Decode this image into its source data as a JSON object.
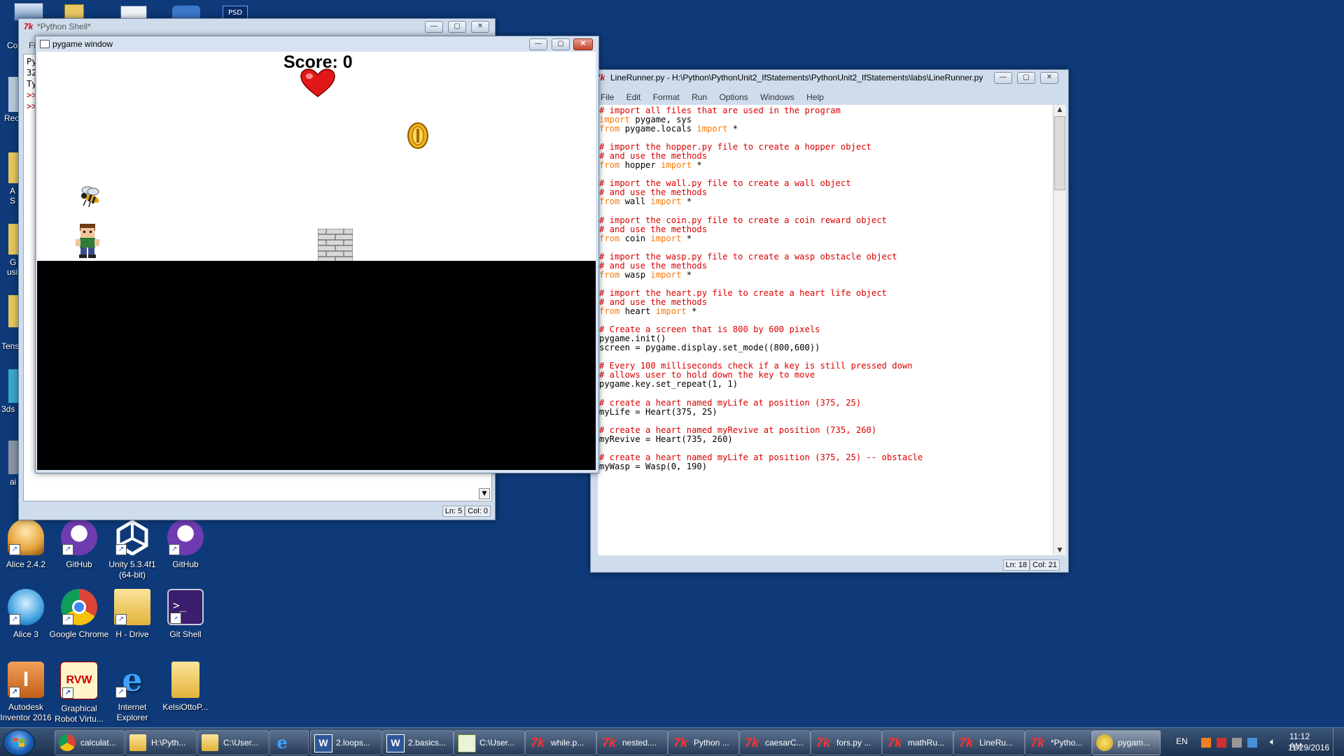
{
  "desktop": {
    "icons": [
      {
        "label": "Alice 2.4.2"
      },
      {
        "label": "GitHub"
      },
      {
        "label": "Unity 5.3.4f1 (64-bit)"
      },
      {
        "label": "GitHub"
      },
      {
        "label": "Alice 3"
      },
      {
        "label": "Google Chrome"
      },
      {
        "label": "H - Drive"
      },
      {
        "label": "Git Shell"
      },
      {
        "label": "Autodesk Inventor 2016"
      },
      {
        "label": "Graphical Robot Virtu..."
      },
      {
        "label": "Internet Explorer"
      },
      {
        "label": "KelsiOttoP..."
      }
    ],
    "edge_labels": [
      "Co",
      "Rec",
      "A",
      "S",
      "G",
      "usi",
      "Tens",
      "3ds",
      "ai"
    ]
  },
  "python_shell": {
    "title": "*Python Shell*",
    "menu_fragment": "Fi",
    "lines": [
      "Py",
      "32",
      "Ty",
      ">>",
      ">>"
    ],
    "status": {
      "ln": "Ln: 5",
      "col": "Col: 0"
    }
  },
  "pygame_window": {
    "title": "pygame window",
    "score_text": "Score: 0",
    "sprites": [
      "heart",
      "coin",
      "wasp",
      "player",
      "brick-wall"
    ]
  },
  "editor": {
    "title": "LineRunner.py - H:\\Python\\PythonUnit2_IfStatements\\PythonUnit2_IfStatements\\labs\\LineRunner.py",
    "menu": [
      "File",
      "Edit",
      "Format",
      "Run",
      "Options",
      "Windows",
      "Help"
    ],
    "status": {
      "ln": "Ln: 18",
      "col": "Col: 21"
    },
    "code": [
      [
        {
          "t": "# import all files that are used in the program",
          "c": "comment"
        }
      ],
      [
        {
          "t": "import",
          "c": "kw"
        },
        {
          "t": " pygame, sys",
          "c": ""
        }
      ],
      [
        {
          "t": "from",
          "c": "kw"
        },
        {
          "t": " pygame.locals ",
          "c": ""
        },
        {
          "t": "import",
          "c": "kw"
        },
        {
          "t": " *",
          "c": ""
        }
      ],
      [],
      [
        {
          "t": "# import the hopper.py file to create a hopper object",
          "c": "comment"
        }
      ],
      [
        {
          "t": "# and use the methods",
          "c": "comment"
        }
      ],
      [
        {
          "t": "from",
          "c": "kw"
        },
        {
          "t": " hopper ",
          "c": ""
        },
        {
          "t": "import",
          "c": "kw"
        },
        {
          "t": " *",
          "c": ""
        }
      ],
      [],
      [
        {
          "t": "# import the wall.py file to create a wall object",
          "c": "comment"
        }
      ],
      [
        {
          "t": "# and use the methods",
          "c": "comment"
        }
      ],
      [
        {
          "t": "from",
          "c": "kw"
        },
        {
          "t": " wall ",
          "c": ""
        },
        {
          "t": "import",
          "c": "kw"
        },
        {
          "t": " *",
          "c": ""
        }
      ],
      [],
      [
        {
          "t": "# import the coin.py file to create a coin reward object",
          "c": "comment"
        }
      ],
      [
        {
          "t": "# and use the methods",
          "c": "comment"
        }
      ],
      [
        {
          "t": "from",
          "c": "kw"
        },
        {
          "t": " coin ",
          "c": ""
        },
        {
          "t": "import",
          "c": "kw"
        },
        {
          "t": " *",
          "c": ""
        }
      ],
      [],
      [
        {
          "t": "# import the wasp.py file to create a wasp obstacle object",
          "c": "comment"
        }
      ],
      [
        {
          "t": "# and use the methods",
          "c": "comment"
        }
      ],
      [
        {
          "t": "from",
          "c": "kw"
        },
        {
          "t": " wasp ",
          "c": ""
        },
        {
          "t": "import",
          "c": "kw"
        },
        {
          "t": " *",
          "c": ""
        }
      ],
      [],
      [
        {
          "t": "# import the heart.py file to create a heart life object",
          "c": "comment"
        }
      ],
      [
        {
          "t": "# and use the methods",
          "c": "comment"
        }
      ],
      [
        {
          "t": "from",
          "c": "kw"
        },
        {
          "t": " heart ",
          "c": ""
        },
        {
          "t": "import",
          "c": "kw"
        },
        {
          "t": " *",
          "c": ""
        }
      ],
      [],
      [
        {
          "t": "# Create a screen that is 800 by 600 pixels",
          "c": "comment"
        }
      ],
      [
        {
          "t": "pygame.init()",
          "c": ""
        }
      ],
      [
        {
          "t": "screen = pygame.display.set_mode((800,600))",
          "c": ""
        }
      ],
      [],
      [
        {
          "t": "# Every 100 milliseconds check if a key is still pressed down",
          "c": "comment"
        }
      ],
      [
        {
          "t": "# allows user to hold down the key to move",
          "c": "comment"
        }
      ],
      [
        {
          "t": "pygame.key.set_repeat(1, 1)",
          "c": ""
        }
      ],
      [],
      [
        {
          "t": "# create a heart named myLife at position (375, 25)",
          "c": "comment"
        }
      ],
      [
        {
          "t": "myLife = Heart(375, 25)",
          "c": ""
        }
      ],
      [],
      [
        {
          "t": "# create a heart named myRevive at position (735, 260)",
          "c": "comment"
        }
      ],
      [
        {
          "t": "myRevive = Heart(735, 260)",
          "c": ""
        }
      ],
      [],
      [
        {
          "t": "# create a heart named myLife at position (375, 25) -- obstacle",
          "c": "comment"
        }
      ],
      [
        {
          "t": "myWasp = Wasp(0, 190)",
          "c": ""
        }
      ]
    ]
  },
  "taskbar": {
    "items": [
      {
        "label": "calculat...",
        "icon": "chrome-icon"
      },
      {
        "label": "H:\\Pyth...",
        "icon": "folder-icon"
      },
      {
        "label": "C:\\User...",
        "icon": "folder-icon"
      },
      {
        "label": "",
        "icon": "ie-icon"
      },
      {
        "label": "2.loops...",
        "icon": "word-icon"
      },
      {
        "label": "2.basics...",
        "icon": "word-icon"
      },
      {
        "label": "C:\\User...",
        "icon": "notepad-icon"
      },
      {
        "label": "while.p...",
        "icon": "idle-icon"
      },
      {
        "label": "nested....",
        "icon": "idle-icon"
      },
      {
        "label": "Python ...",
        "icon": "idle-icon"
      },
      {
        "label": "caesarC...",
        "icon": "idle-icon"
      },
      {
        "label": "fors.py ...",
        "icon": "idle-icon"
      },
      {
        "label": "mathRu...",
        "icon": "idle-icon"
      },
      {
        "label": "LineRu...",
        "icon": "idle-icon"
      },
      {
        "label": "*Pytho...",
        "icon": "idle-icon"
      },
      {
        "label": "pygam...",
        "icon": "pygame-icon"
      }
    ],
    "lang": "EN",
    "time": "11:12 AM",
    "date": "11/29/2016"
  }
}
